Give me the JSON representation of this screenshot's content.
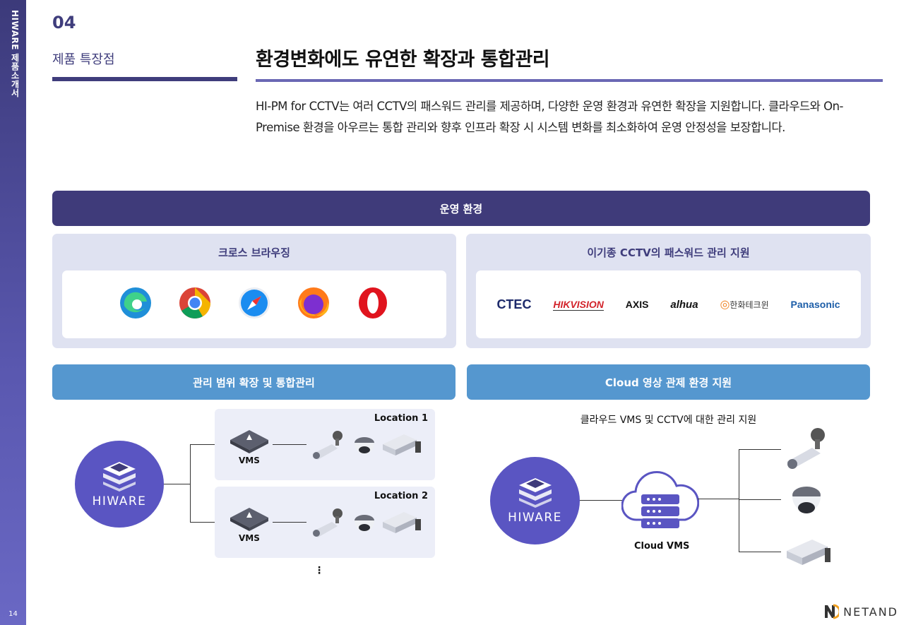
{
  "sidebar": {
    "title": "HIWARE 제품소개서",
    "page": "14"
  },
  "section": {
    "number": "04",
    "name": "제품 특장점"
  },
  "heading": "환경변화에도 유연한 확장과 통합관리",
  "description": "HI-PM for CCTV는 여러 CCTV의 패스워드 관리를 제공하며, 다양한 운영 환경과 유연한 확장을 지원합니다. 클라우드와 On-Premise 환경을 아우르는 통합 관리와 향후 인프라 확장 시 시스템 변화를 최소화하여 운영 안정성을 보장합니다.",
  "op_env": "운영 환경",
  "cross_browsing": {
    "title": "크로스 브라우징",
    "icons": [
      "edge-icon",
      "chrome-icon",
      "safari-icon",
      "firefox-icon",
      "opera-icon"
    ]
  },
  "vendors": {
    "title": "이기종 CCTV의 패스워드 관리 지원",
    "brands": [
      "CTEC",
      "HIKVISION",
      "AXIS",
      "alhua",
      "한화테크윈",
      "Panasonic"
    ]
  },
  "scope": {
    "title": "관리 범위 확장 및 통합관리",
    "hub": "HIWARE",
    "locations": [
      {
        "name": "Location 1",
        "vms": "VMS"
      },
      {
        "name": "Location 2",
        "vms": "VMS"
      }
    ],
    "more": "⋮"
  },
  "cloud": {
    "title": "Cloud 영상 관제 환경 지원",
    "subtitle": "클라우드 VMS 및 CCTV에 대한 관리 지원",
    "hub": "HIWARE",
    "node": "Cloud VMS"
  },
  "footer": {
    "brand": "NETAND"
  },
  "colors": {
    "primary": "#3f3b7a",
    "accent": "#5597cf",
    "panel": "#dfe2f1",
    "hub": "#5a55c2"
  }
}
